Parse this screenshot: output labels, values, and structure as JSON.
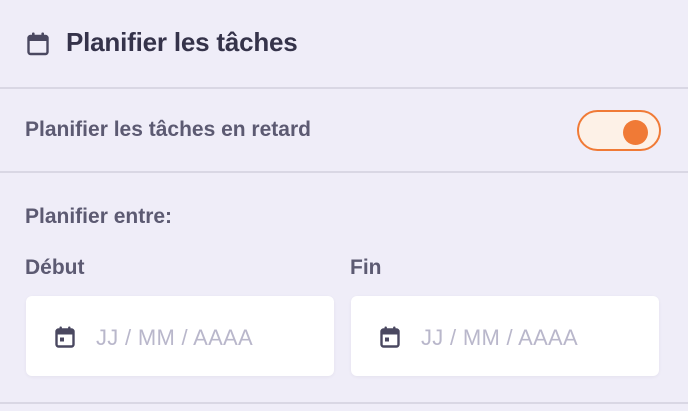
{
  "header": {
    "title": "Planifier les tâches",
    "icon": "calendar-icon"
  },
  "late_tasks": {
    "label": "Planifier les tâches en retard",
    "toggle_on": true,
    "accent": "#f07a36"
  },
  "range": {
    "label": "Planifier entre:",
    "start": {
      "label": "Début",
      "placeholder": "JJ / MM / AAAA",
      "value": "",
      "icon": "calendar-icon"
    },
    "end": {
      "label": "Fin",
      "placeholder": "JJ / MM / AAAA",
      "value": "",
      "icon": "calendar-icon"
    }
  }
}
